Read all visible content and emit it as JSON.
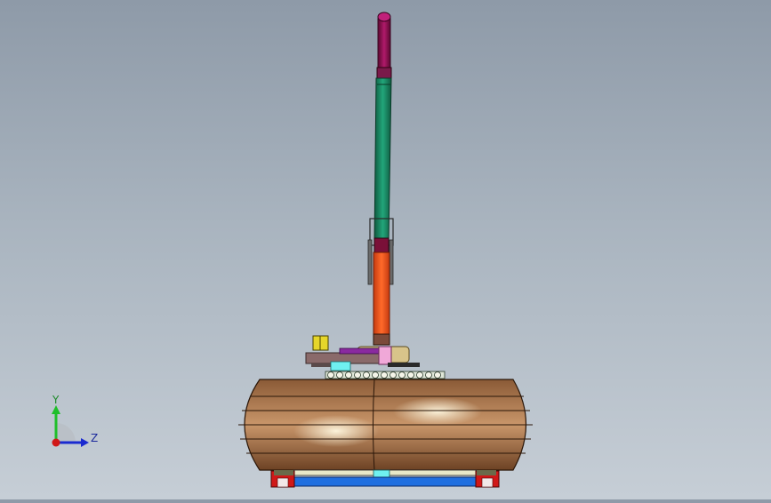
{
  "viewport": {
    "background_top": "#8e9aa8",
    "background_bottom": "#c6ced6",
    "model": {
      "name": "assembly-model-side-view",
      "colors": {
        "tip": "#a01060",
        "upper_arm": "#1b8a64",
        "joint": "#7a1038",
        "cylinder": "#f05a1e",
        "base_plate": "#8a6a6a",
        "drum": "#b8845a",
        "rail": "#1f6fe0",
        "rail_end": "#d01818",
        "accent_yellow": "#e6d62a",
        "accent_pink": "#f0a8d8",
        "accent_purple": "#8a2aa0",
        "accent_cyan": "#6ff0f0"
      }
    }
  },
  "triad": {
    "y_label": "Y",
    "z_label": "Z",
    "colors": {
      "y": "#1fbf2a",
      "z": "#1a2ad0",
      "x": "#d01818"
    }
  }
}
